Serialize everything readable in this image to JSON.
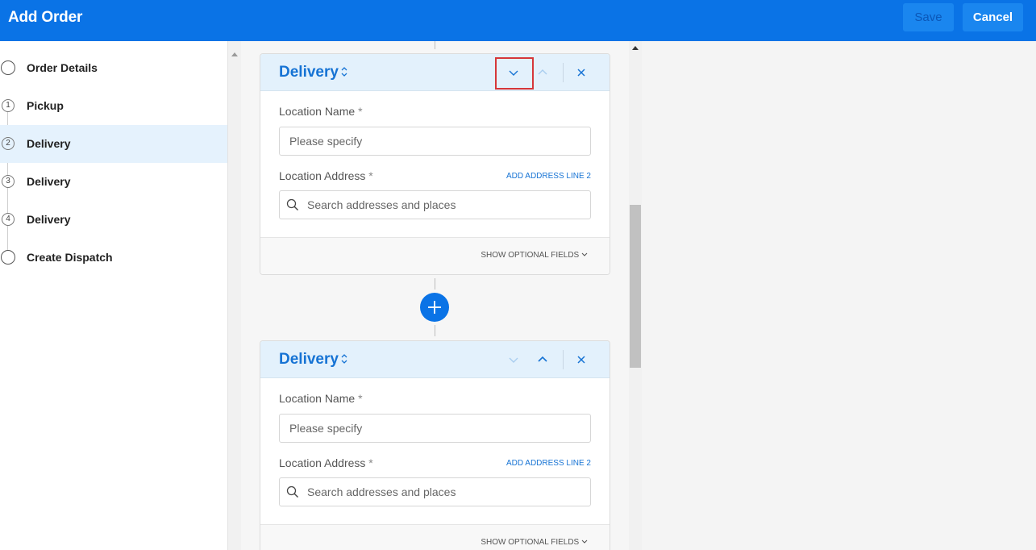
{
  "header": {
    "title": "Add Order",
    "save_label": "Save",
    "cancel_label": "Cancel"
  },
  "sidebar": {
    "steps": [
      {
        "number": "",
        "label": "Order Details"
      },
      {
        "number": "1",
        "label": "Pickup"
      },
      {
        "number": "2",
        "label": "Delivery"
      },
      {
        "number": "3",
        "label": "Delivery"
      },
      {
        "number": "4",
        "label": "Delivery"
      },
      {
        "number": "",
        "label": "Create Dispatch"
      }
    ],
    "active_step": "2"
  },
  "cards": [
    {
      "title": "Delivery",
      "location_name_label": "Location Name",
      "location_name_placeholder": "Please specify",
      "location_address_label": "Location Address",
      "required_mark": "*",
      "add_address_line": "ADD ADDRESS LINE 2",
      "search_placeholder": "Search addresses and places",
      "optional_fields": "SHOW OPTIONAL FIELDS"
    },
    {
      "title": "Delivery",
      "location_name_label": "Location Name",
      "location_name_placeholder": "Please specify",
      "location_address_label": "Location Address",
      "required_mark": "*",
      "add_address_line": "ADD ADDRESS LINE 2",
      "search_placeholder": "Search addresses and places",
      "optional_fields": "SHOW OPTIONAL FIELDS"
    }
  ],
  "icons": {
    "move_down": "chevron-down-icon",
    "move_up": "chevron-up-icon",
    "remove": "close-icon",
    "reorder": "sort-icon",
    "search": "search-icon",
    "add_stop": "plus-icon"
  },
  "colors": {
    "brand": "#0a73e6",
    "accent_text": "#1673d4",
    "highlight": "#d6373a",
    "active_bg": "#e5f2fd"
  }
}
